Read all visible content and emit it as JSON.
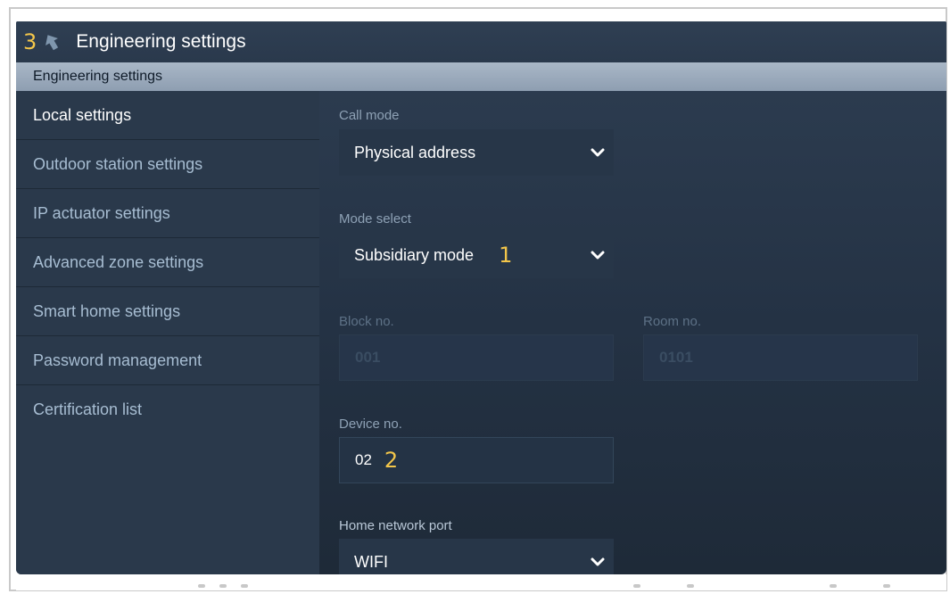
{
  "titlebar": {
    "callout": "3",
    "title": "Engineering settings",
    "back_icon": "back-arrow-icon"
  },
  "section": {
    "title": "Engineering settings"
  },
  "sidebar": {
    "items": [
      {
        "label": "Local settings",
        "active": true
      },
      {
        "label": "Outdoor station settings"
      },
      {
        "label": "IP actuator settings"
      },
      {
        "label": "Advanced zone settings"
      },
      {
        "label": "Smart home settings"
      },
      {
        "label": "Password management"
      },
      {
        "label": "Certification list"
      }
    ]
  },
  "form": {
    "call_mode": {
      "label": "Call mode",
      "value": "Physical address"
    },
    "mode_select": {
      "label": "Mode select",
      "value": "Subsidiary mode",
      "callout": "1"
    },
    "block_no": {
      "label": "Block no.",
      "value": "001"
    },
    "room_no": {
      "label": "Room no.",
      "value": "0101"
    },
    "device_no": {
      "label": "Device no.",
      "value": "02",
      "callout": "2"
    },
    "home_network_port": {
      "label": "Home network port",
      "value": "WIFI"
    }
  },
  "colors": {
    "callout": "#f3c64a",
    "background": "#243244",
    "section_bar": "#9aa9bb"
  }
}
